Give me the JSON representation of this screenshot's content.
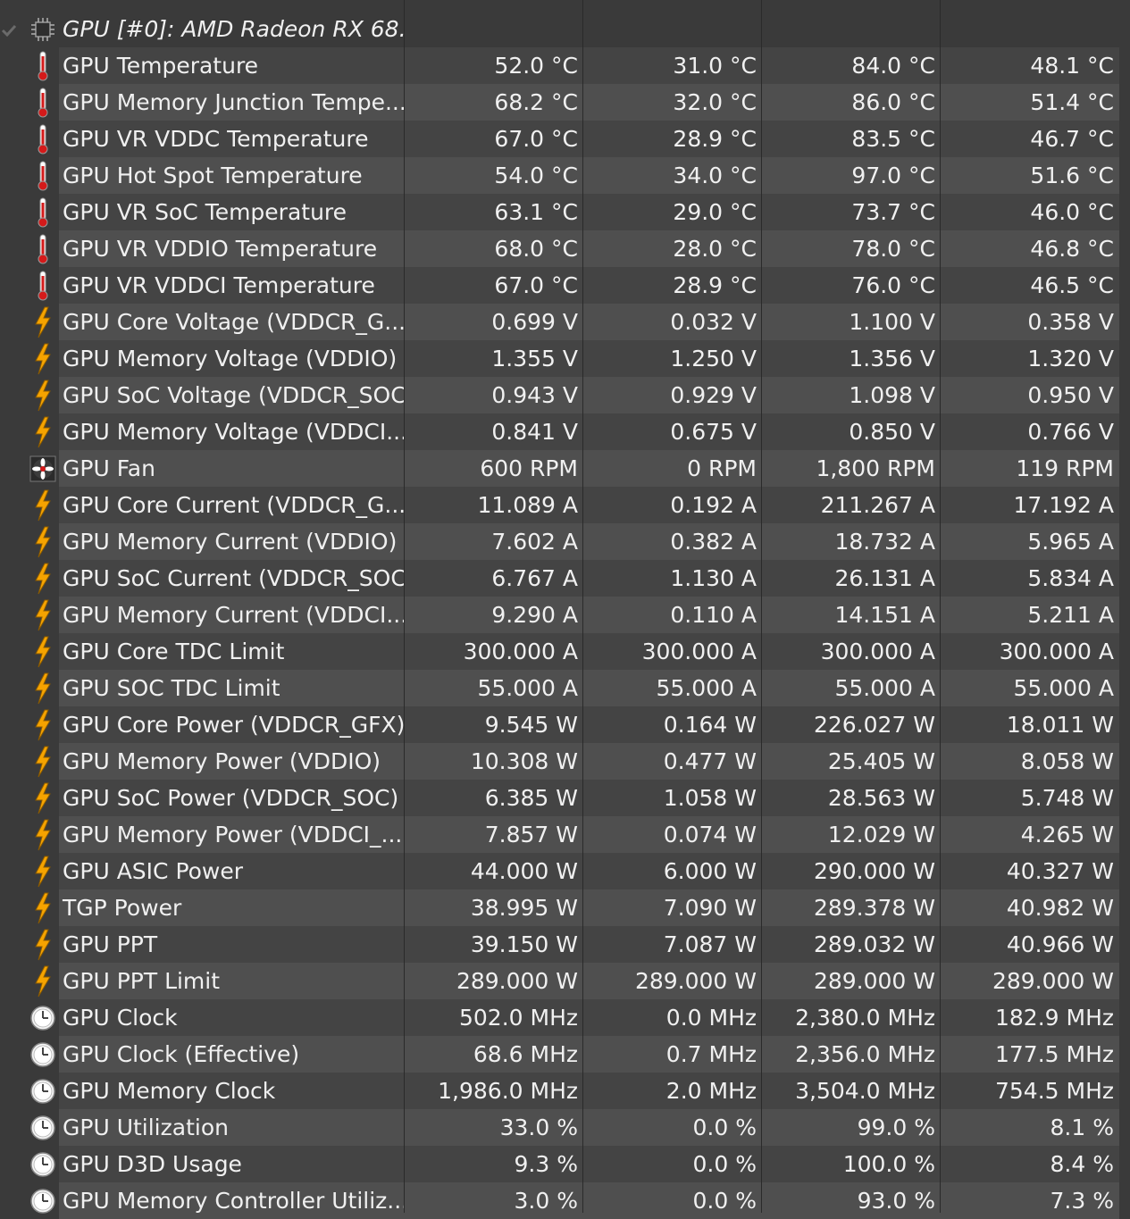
{
  "group": {
    "title": "GPU [#0]: AMD Radeon RX 68...",
    "icon": "chip-icon",
    "collapse_icon": "checkmark-collapse-icon"
  },
  "rows": [
    {
      "icon": "thermometer-icon",
      "label": "GPU Temperature",
      "current": "52.0 °C",
      "min": "31.0 °C",
      "max": "84.0 °C",
      "avg": "48.1 °C"
    },
    {
      "icon": "thermometer-icon",
      "label": "GPU Memory Junction Tempe...",
      "current": "68.2 °C",
      "min": "32.0 °C",
      "max": "86.0 °C",
      "avg": "51.4 °C"
    },
    {
      "icon": "thermometer-icon",
      "label": "GPU VR VDDC Temperature",
      "current": "67.0 °C",
      "min": "28.9 °C",
      "max": "83.5 °C",
      "avg": "46.7 °C"
    },
    {
      "icon": "thermometer-icon",
      "label": "GPU Hot Spot Temperature",
      "current": "54.0 °C",
      "min": "34.0 °C",
      "max": "97.0 °C",
      "avg": "51.6 °C"
    },
    {
      "icon": "thermometer-icon",
      "label": "GPU VR SoC Temperature",
      "current": "63.1 °C",
      "min": "29.0 °C",
      "max": "73.7 °C",
      "avg": "46.0 °C"
    },
    {
      "icon": "thermometer-icon",
      "label": "GPU VR VDDIO Temperature",
      "current": "68.0 °C",
      "min": "28.0 °C",
      "max": "78.0 °C",
      "avg": "46.8 °C"
    },
    {
      "icon": "thermometer-icon",
      "label": "GPU VR VDDCI Temperature",
      "current": "67.0 °C",
      "min": "28.9 °C",
      "max": "76.0 °C",
      "avg": "46.5 °C"
    },
    {
      "icon": "lightning-icon",
      "label": "GPU Core Voltage (VDDCR_G...",
      "current": "0.699 V",
      "min": "0.032 V",
      "max": "1.100 V",
      "avg": "0.358 V"
    },
    {
      "icon": "lightning-icon",
      "label": "GPU Memory Voltage (VDDIO)",
      "current": "1.355 V",
      "min": "1.250 V",
      "max": "1.356 V",
      "avg": "1.320 V"
    },
    {
      "icon": "lightning-icon",
      "label": "GPU SoC Voltage (VDDCR_SOC)",
      "current": "0.943 V",
      "min": "0.929 V",
      "max": "1.098 V",
      "avg": "0.950 V"
    },
    {
      "icon": "lightning-icon",
      "label": "GPU Memory Voltage (VDDCI...",
      "current": "0.841 V",
      "min": "0.675 V",
      "max": "0.850 V",
      "avg": "0.766 V"
    },
    {
      "icon": "fan-icon",
      "label": "GPU Fan",
      "current": "600 RPM",
      "min": "0 RPM",
      "max": "1,800 RPM",
      "avg": "119 RPM"
    },
    {
      "icon": "lightning-icon",
      "label": "GPU Core Current (VDDCR_G...",
      "current": "11.089 A",
      "min": "0.192 A",
      "max": "211.267 A",
      "avg": "17.192 A"
    },
    {
      "icon": "lightning-icon",
      "label": "GPU Memory Current (VDDIO)",
      "current": "7.602 A",
      "min": "0.382 A",
      "max": "18.732 A",
      "avg": "5.965 A"
    },
    {
      "icon": "lightning-icon",
      "label": "GPU SoC Current (VDDCR_SOC)",
      "current": "6.767 A",
      "min": "1.130 A",
      "max": "26.131 A",
      "avg": "5.834 A"
    },
    {
      "icon": "lightning-icon",
      "label": "GPU Memory Current (VDDCI...",
      "current": "9.290 A",
      "min": "0.110 A",
      "max": "14.151 A",
      "avg": "5.211 A"
    },
    {
      "icon": "lightning-icon",
      "label": "GPU Core TDC Limit",
      "current": "300.000 A",
      "min": "300.000 A",
      "max": "300.000 A",
      "avg": "300.000 A"
    },
    {
      "icon": "lightning-icon",
      "label": "GPU SOC TDC Limit",
      "current": "55.000 A",
      "min": "55.000 A",
      "max": "55.000 A",
      "avg": "55.000 A"
    },
    {
      "icon": "lightning-icon",
      "label": "GPU Core Power (VDDCR_GFX)",
      "current": "9.545 W",
      "min": "0.164 W",
      "max": "226.027 W",
      "avg": "18.011 W"
    },
    {
      "icon": "lightning-icon",
      "label": "GPU Memory Power (VDDIO)",
      "current": "10.308 W",
      "min": "0.477 W",
      "max": "25.405 W",
      "avg": "8.058 W"
    },
    {
      "icon": "lightning-icon",
      "label": "GPU SoC Power (VDDCR_SOC)",
      "current": "6.385 W",
      "min": "1.058 W",
      "max": "28.563 W",
      "avg": "5.748 W"
    },
    {
      "icon": "lightning-icon",
      "label": "GPU Memory Power (VDDCI_...",
      "current": "7.857 W",
      "min": "0.074 W",
      "max": "12.029 W",
      "avg": "4.265 W"
    },
    {
      "icon": "lightning-icon",
      "label": "GPU ASIC Power",
      "current": "44.000 W",
      "min": "6.000 W",
      "max": "290.000 W",
      "avg": "40.327 W"
    },
    {
      "icon": "lightning-icon",
      "label": "TGP Power",
      "current": "38.995 W",
      "min": "7.090 W",
      "max": "289.378 W",
      "avg": "40.982 W"
    },
    {
      "icon": "lightning-icon",
      "label": "GPU PPT",
      "current": "39.150 W",
      "min": "7.087 W",
      "max": "289.032 W",
      "avg": "40.966 W"
    },
    {
      "icon": "lightning-icon",
      "label": "GPU PPT Limit",
      "current": "289.000 W",
      "min": "289.000 W",
      "max": "289.000 W",
      "avg": "289.000 W"
    },
    {
      "icon": "clock-icon",
      "label": "GPU Clock",
      "current": "502.0 MHz",
      "min": "0.0 MHz",
      "max": "2,380.0 MHz",
      "avg": "182.9 MHz"
    },
    {
      "icon": "clock-icon",
      "label": "GPU Clock (Effective)",
      "current": "68.6 MHz",
      "min": "0.7 MHz",
      "max": "2,356.0 MHz",
      "avg": "177.5 MHz"
    },
    {
      "icon": "clock-icon",
      "label": "GPU Memory Clock",
      "current": "1,986.0 MHz",
      "min": "2.0 MHz",
      "max": "3,504.0 MHz",
      "avg": "754.5 MHz"
    },
    {
      "icon": "clock-icon",
      "label": "GPU Utilization",
      "current": "33.0 %",
      "min": "0.0 %",
      "max": "99.0 %",
      "avg": "8.1 %"
    },
    {
      "icon": "clock-icon",
      "label": "GPU D3D Usage",
      "current": "9.3 %",
      "min": "0.0 %",
      "max": "100.0 %",
      "avg": "8.4 %"
    },
    {
      "icon": "clock-icon",
      "label": "GPU Memory Controller Utiliz...",
      "current": "3.0 %",
      "min": "0.0 %",
      "max": "93.0 %",
      "avg": "7.3 %"
    }
  ]
}
